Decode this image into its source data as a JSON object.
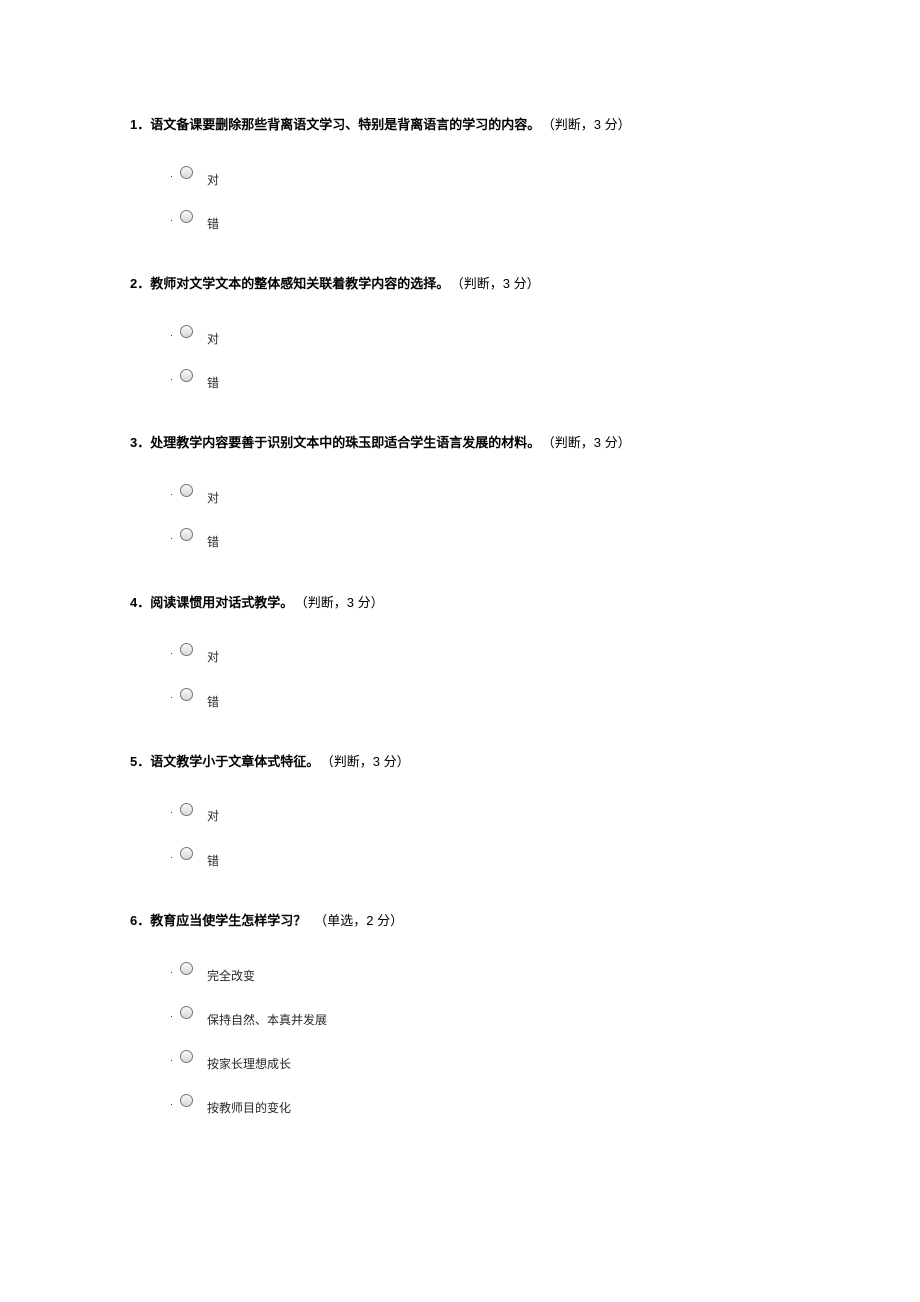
{
  "questions": [
    {
      "number": "1．",
      "text": "语文备课要删除那些背离语文学习、特别是背离语言的学习的内容。",
      "meta": "（判断，3 分）",
      "options": [
        "对",
        "错"
      ]
    },
    {
      "number": "2．",
      "text": "教师对文学文本的整体感知关联着教学内容的选择。",
      "meta": "（判断，3 分）",
      "options": [
        "对",
        "错"
      ]
    },
    {
      "number": "3．",
      "text": "处理教学内容要善于识别文本中的珠玉即适合学生语言发展的材料。",
      "meta": "（判断，3 分）",
      "options": [
        "对",
        "错"
      ]
    },
    {
      "number": "4．",
      "text": "阅读课惯用对话式教学。",
      "meta": "（判断，3 分）",
      "options": [
        "对",
        "错"
      ]
    },
    {
      "number": "5．",
      "text": "语文教学小于文章体式特征。",
      "meta": "（判断，3 分）",
      "options": [
        "对",
        "错"
      ]
    },
    {
      "number": "6．",
      "text": "教育应当使学生怎样学习？",
      "meta": "（单选，2 分）",
      "options": [
        "完全改变",
        "保持自然、本真并发展",
        "按家长理想成长",
        "按教师目的变化"
      ]
    }
  ]
}
